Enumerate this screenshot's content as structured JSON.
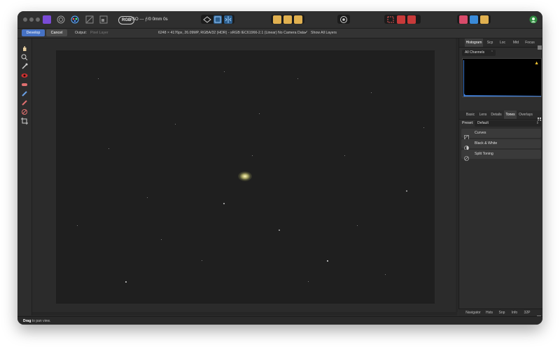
{
  "titlebar": {
    "rgb_badge": "RGB",
    "exposure": "ISO --- ƒ/0 0mm 0s"
  },
  "context_toolbar": {
    "develop_label": "Develop",
    "cancel_label": "Cancel",
    "output_label": "Output:",
    "output_value": "Pixel Layer",
    "image_info": "6248 × 4176px, 26.09MP, RGBA/32 (HDR) - sRGB IEC61966-2.1 (Linear)",
    "camera_data": "No Camera Data",
    "show_all_layers_label": "Show All Layers",
    "show_all_layers_checked": true
  },
  "panel": {
    "top_tabs": [
      "Histogram",
      "Scp",
      "Loc",
      "Mtd",
      "Focus"
    ],
    "top_active": "Histogram",
    "channels_value": "All Channels",
    "develop_tabs": [
      "Basic",
      "Lens",
      "Details",
      "Tones",
      "Overlays"
    ],
    "develop_active": "Tones",
    "preset_label": "Preset:",
    "preset_value": "Default",
    "adjustments": [
      "Curves",
      "Black & White",
      "Split Toning"
    ],
    "bottom_tabs": [
      "Navigator",
      "Hsts",
      "Snp",
      "Info",
      "32P"
    ]
  },
  "status": {
    "bold": "Drag",
    "rest": " to pan view."
  },
  "colors": {
    "accent_blue": "#4672c4",
    "histogram_blue": "#3f7bd1",
    "warning": "#f1c232"
  }
}
